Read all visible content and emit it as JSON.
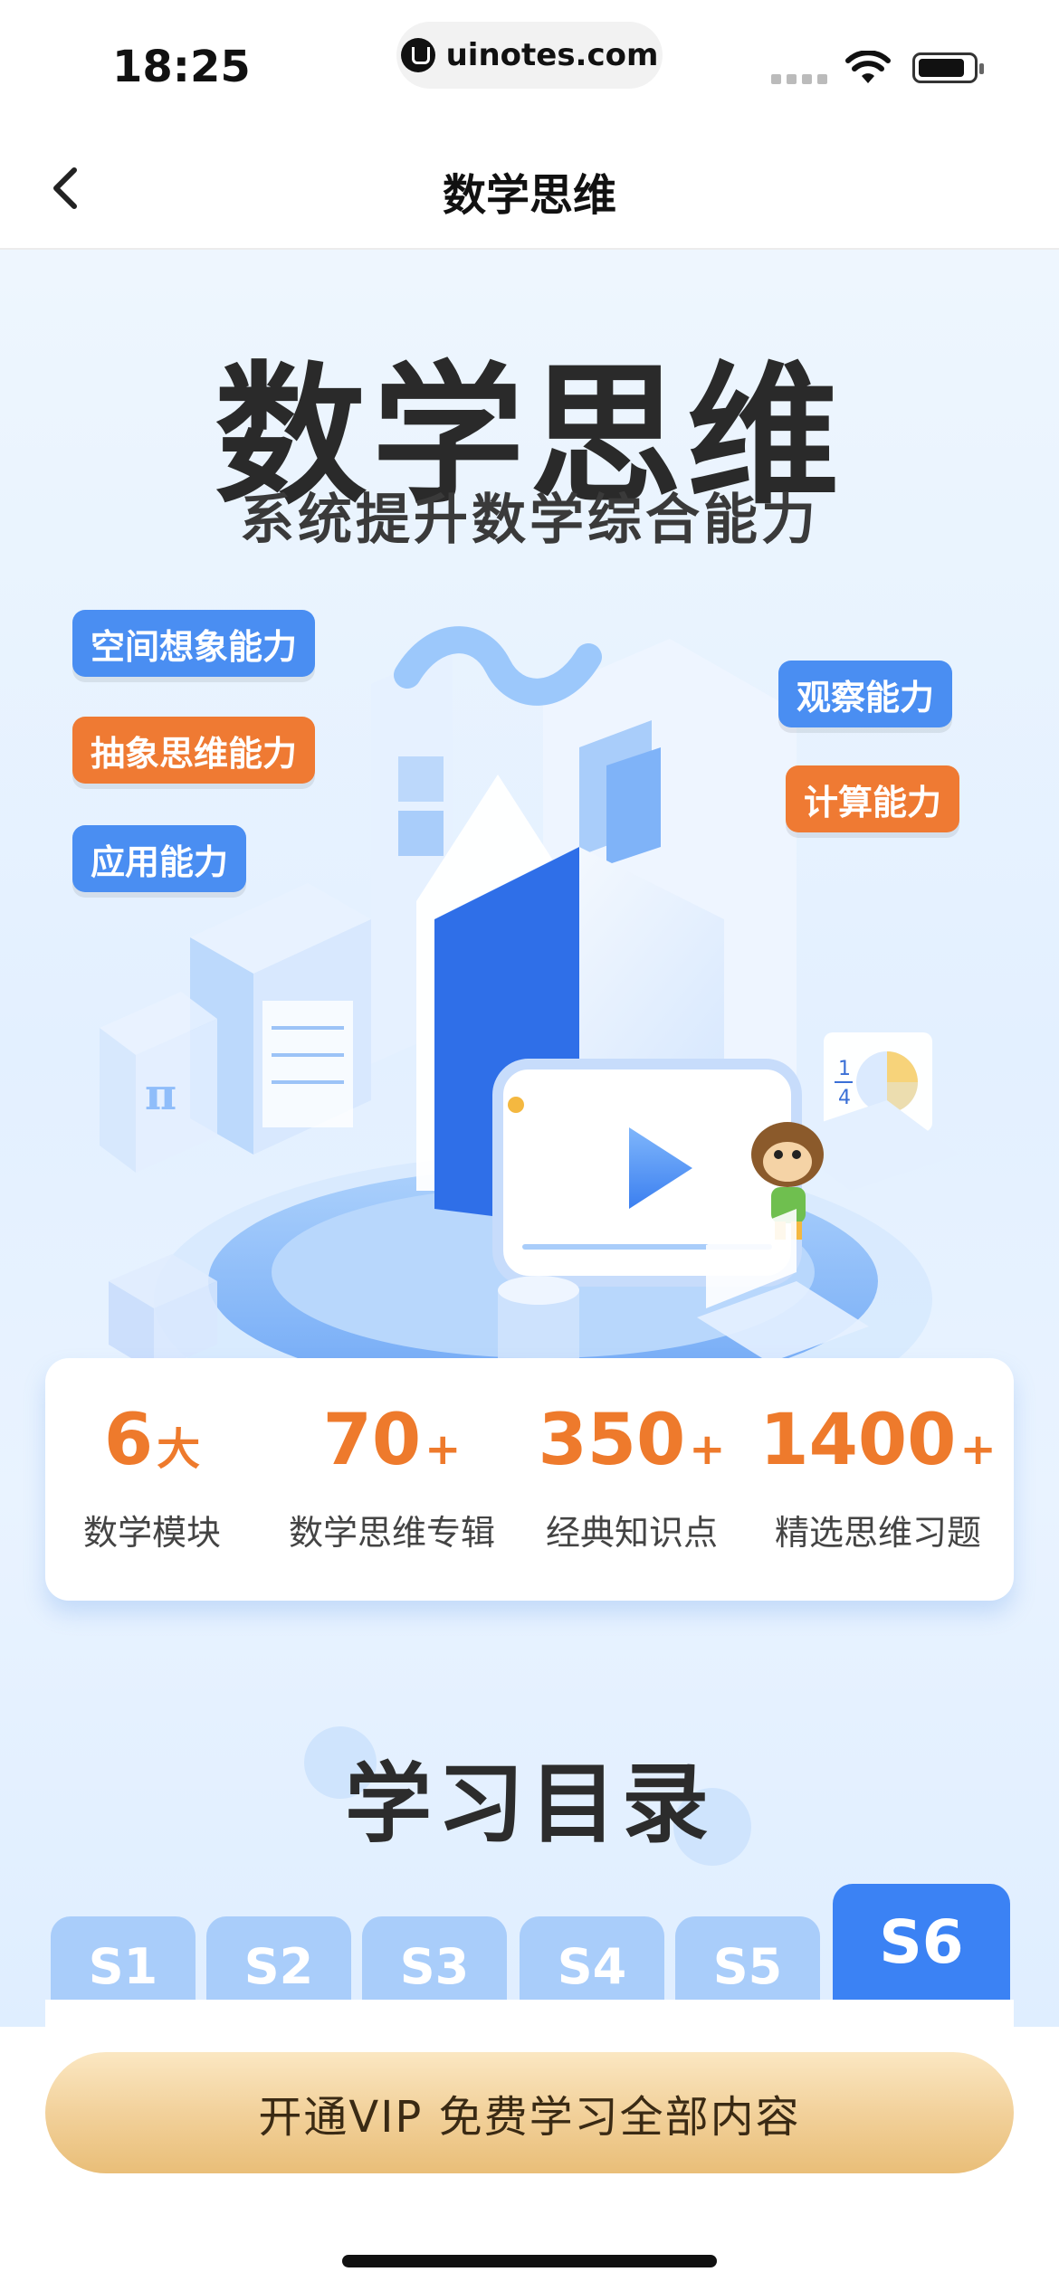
{
  "status_bar": {
    "time": "18:25",
    "url": "uinotes.com"
  },
  "nav": {
    "title": "数学思维",
    "back_icon": "chevron-left-icon"
  },
  "hero": {
    "title": "数学思维",
    "subtitle": "系统提升数学综合能力",
    "tags": [
      {
        "label": "空间想象能力",
        "color": "#4a8ef2"
      },
      {
        "label": "抽象思维能力",
        "color": "#ef7a33"
      },
      {
        "label": "应用能力",
        "color": "#4a8ef2"
      },
      {
        "label": "观察能力",
        "color": "#4a8ef2"
      },
      {
        "label": "计算能力",
        "color": "#ef7a33"
      }
    ],
    "illustration_fraction": {
      "numerator": "1",
      "denominator": "4"
    },
    "illustration_pi": "π"
  },
  "stats": [
    {
      "value": "6",
      "suffix": "大",
      "label": "数学模块"
    },
    {
      "value": "70",
      "suffix": "+",
      "label": "数学思维专辑"
    },
    {
      "value": "350",
      "suffix": "+",
      "label": "经典知识点"
    },
    {
      "value": "1400",
      "suffix": "+",
      "label": "精选思维习题"
    }
  ],
  "catalog": {
    "title": "学习目录",
    "tabs": [
      {
        "label": "S1",
        "active": false
      },
      {
        "label": "S2",
        "active": false
      },
      {
        "label": "S3",
        "active": false
      },
      {
        "label": "S4",
        "active": false
      },
      {
        "label": "S5",
        "active": false
      },
      {
        "label": "S6",
        "active": true
      }
    ]
  },
  "footer": {
    "vip_button": "开通VIP 免费学习全部内容"
  },
  "colors": {
    "accent_blue": "#3b82f4",
    "tab_inactive": "#a9cdfa",
    "stat_orange": "#ee7a2c",
    "vip_gold": "#f2d19b"
  }
}
